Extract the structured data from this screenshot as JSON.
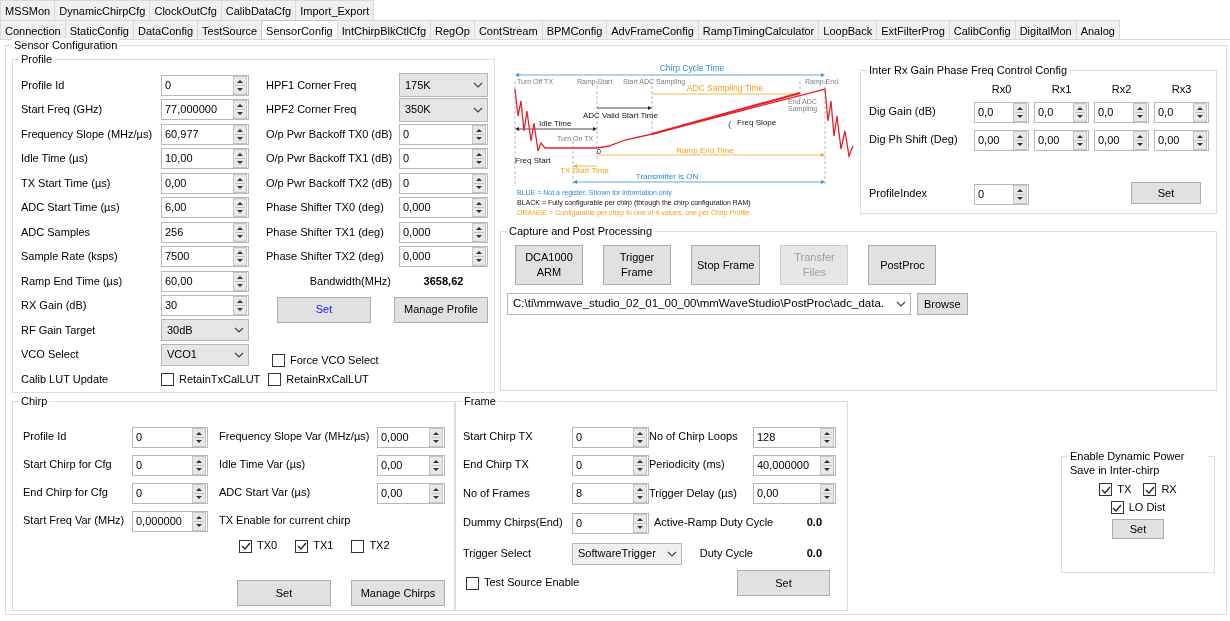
{
  "tab_rows": [
    [
      {
        "label": "MSSMon",
        "selected": false
      },
      {
        "label": "DynamicChirpCfg",
        "selected": false
      },
      {
        "label": "ClockOutCfg",
        "selected": false
      },
      {
        "label": "CalibDataCfg",
        "selected": false
      },
      {
        "label": "Import_Export",
        "selected": false
      }
    ],
    [
      {
        "label": "Connection",
        "selected": false
      },
      {
        "label": "StaticConfig",
        "selected": false
      },
      {
        "label": "DataConfig",
        "selected": false
      },
      {
        "label": "TestSource",
        "selected": false
      },
      {
        "label": "SensorConfig",
        "selected": true
      },
      {
        "label": "IntChirpBlkCtlCfg",
        "selected": false
      },
      {
        "label": "RegOp",
        "selected": false
      },
      {
        "label": "ContStream",
        "selected": false
      },
      {
        "label": "BPMConfig",
        "selected": false
      },
      {
        "label": "AdvFrameConfig",
        "selected": false
      },
      {
        "label": "RampTimingCalculator",
        "selected": false
      },
      {
        "label": "LoopBack",
        "selected": false
      },
      {
        "label": "ExtFilterProg",
        "selected": false
      },
      {
        "label": "CalibConfig",
        "selected": false
      },
      {
        "label": "DigitalMon",
        "selected": false
      },
      {
        "label": "Analog",
        "selected": false
      }
    ]
  ],
  "sensor": {
    "title": "Sensor Configuration"
  },
  "profile": {
    "title": "Profile",
    "left": [
      {
        "kind": "spin",
        "label": "Profile Id",
        "value": "0"
      },
      {
        "kind": "spin",
        "label": "Start Freq (GHz)",
        "value": "77,000000"
      },
      {
        "kind": "spin",
        "label": "Frequency Slope (MHz/µs)",
        "value": "60,977"
      },
      {
        "kind": "spin",
        "label": "Idle Time (µs)",
        "value": "10,00"
      },
      {
        "kind": "spin",
        "label": "TX Start Time (µs)",
        "value": "0,00"
      },
      {
        "kind": "spin",
        "label": "ADC Start Time (µs)",
        "value": "6,00"
      },
      {
        "kind": "spin",
        "label": "ADC Samples",
        "value": "256"
      },
      {
        "kind": "spin",
        "label": "Sample Rate (ksps)",
        "value": "7500"
      },
      {
        "kind": "spin",
        "label": "Ramp End Time (µs)",
        "value": "60,00"
      },
      {
        "kind": "spin",
        "label": "RX Gain (dB)",
        "value": "30"
      },
      {
        "kind": "select",
        "label": "RF Gain Target",
        "value": "30dB"
      },
      {
        "kind": "select",
        "label": "VCO Select",
        "value": "VCO1"
      }
    ],
    "right": [
      {
        "kind": "select",
        "label": "HPF1 Corner Freq",
        "value": "175K"
      },
      {
        "kind": "select",
        "label": "HPF2 Corner Freq",
        "value": "350K"
      },
      {
        "kind": "spin",
        "label": "O/p Pwr Backoff TX0 (dB)",
        "value": "0"
      },
      {
        "kind": "spin",
        "label": "O/p Pwr Backoff TX1 (dB)",
        "value": "0"
      },
      {
        "kind": "spin",
        "label": "O/p Pwr Backoff TX2 (dB)",
        "value": "0"
      },
      {
        "kind": "spin",
        "label": "Phase Shifter TX0 (deg)",
        "value": "0,000"
      },
      {
        "kind": "spin",
        "label": "Phase Shifter TX1 (deg)",
        "value": "0,000"
      },
      {
        "kind": "spin",
        "label": "Phase Shifter TX2 (deg)",
        "value": "0,000"
      }
    ],
    "bandwidth": {
      "label": "Bandwidth(MHz)",
      "value": "3658,62"
    },
    "buttons": [
      {
        "label": "Set",
        "focused": true
      },
      {
        "label": "Manage Profile",
        "focused": false
      }
    ],
    "force_vco": {
      "label": "Force VCO Select",
      "checked": false
    },
    "calib": {
      "label": "Calib LUT Update",
      "options": [
        {
          "label": "RetainTxCalLUT",
          "checked": false
        },
        {
          "label": "RetainRxCalLUT",
          "checked": false
        }
      ]
    }
  },
  "diagram": {
    "labels": [
      {
        "text": "Chirp Cycle Time",
        "kind": "info"
      },
      {
        "text": "Turn Off TX",
        "kind": "marker"
      },
      {
        "text": "Ramp Start",
        "kind": "marker"
      },
      {
        "text": "Start ADC Sampling",
        "kind": "marker"
      },
      {
        "text": "Ramp End",
        "kind": "marker"
      },
      {
        "text": "ADC Sampling Time",
        "kind": "profile"
      },
      {
        "text": "End ADC",
        "kind": "marker"
      },
      {
        "text": "Sampling",
        "kind": "marker"
      },
      {
        "text": "ADC Valid Start Time",
        "kind": "chirp"
      },
      {
        "text": "Idle Time",
        "kind": "chirp"
      },
      {
        "text": "Freq Slope",
        "kind": "chirp"
      },
      {
        "text": "Turn On TX",
        "kind": "marker"
      },
      {
        "text": "0",
        "kind": "chirp"
      },
      {
        "text": "Freq Start",
        "kind": "chirp"
      },
      {
        "text": "Ramp End Time",
        "kind": "profile"
      },
      {
        "text": "TX Start Time",
        "kind": "profile"
      },
      {
        "text": "Transmitter is ON",
        "kind": "info"
      },
      {
        "text": "BLUE = Not a register. Shown for information only",
        "kind": "info"
      },
      {
        "text": "BLACK = Fully configurable per chirp (through the chirp configuration RAM)",
        "kind": "chirp"
      },
      {
        "text": "ORANGE = Configurable per chirp to one of 4 values, one per Chirp Profile",
        "kind": "profile"
      }
    ]
  },
  "inter_rx": {
    "title": "Inter Rx Gain Phase Freq Control Config",
    "columns": [
      "Rx0",
      "Rx1",
      "Rx2",
      "Rx3"
    ],
    "rows": [
      {
        "label": "Dig Gain (dB)",
        "values": [
          "0,0",
          "0,0",
          "0,0",
          "0,0"
        ]
      },
      {
        "label": "Dig Ph Shift (Deg)",
        "values": [
          "0,00",
          "0,00",
          "0,00",
          "0,00"
        ]
      }
    ],
    "profile_index": {
      "label": "ProfileIndex",
      "value": "0"
    },
    "button": "Set"
  },
  "capture": {
    "title": "Capture and Post Processing",
    "buttons": [
      {
        "label": "DCA1000\nARM",
        "disabled": false
      },
      {
        "label": "Trigger\nFrame",
        "disabled": false
      },
      {
        "label": "Stop Frame",
        "disabled": false
      },
      {
        "label": "Transfer\nFiles",
        "disabled": true
      },
      {
        "label": "PostProc",
        "disabled": false
      }
    ],
    "path": "C:\\ti\\mmwave_studio_02_01_00_00\\mmWaveStudio\\PostProc\\adc_data.",
    "browse": "Browse"
  },
  "chirp": {
    "title": "Chirp",
    "left": [
      {
        "label": "Profile Id",
        "value": "0"
      },
      {
        "label": "Start Chirp for Cfg",
        "value": "0"
      },
      {
        "label": "End Chirp for Cfg",
        "value": "0"
      },
      {
        "label": "Start Freq Var (MHz)",
        "value": "0,000000"
      }
    ],
    "right": [
      {
        "label": "Frequency Slope Var (MHz/µs)",
        "value": "0,000"
      },
      {
        "label": "Idle Time Var (µs)",
        "value": "0,00"
      },
      {
        "label": "ADC Start Var (µs)",
        "value": "0,00"
      }
    ],
    "tx_enable": {
      "label": "TX Enable for current chirp",
      "options": [
        {
          "label": "TX0",
          "checked": true
        },
        {
          "label": "TX1",
          "checked": true
        },
        {
          "label": "TX2",
          "checked": false
        }
      ]
    },
    "buttons": [
      "Set",
      "Manage Chirps"
    ]
  },
  "frame": {
    "title": "Frame",
    "left": [
      {
        "kind": "spin",
        "label": "Start Chirp TX",
        "value": "0"
      },
      {
        "kind": "spin",
        "label": "End Chirp TX",
        "value": "0"
      },
      {
        "kind": "spin",
        "label": "No of Frames",
        "value": "8"
      },
      {
        "kind": "spin",
        "label": "Dummy Chirps(End)",
        "value": "0"
      },
      {
        "kind": "select",
        "label": "Trigger Select",
        "value": "SoftwareTrigger"
      }
    ],
    "right": [
      {
        "label": "No of Chirp Loops",
        "value": "128"
      },
      {
        "label": "Periodicity (ms)",
        "value": "40,000000"
      },
      {
        "label": "Trigger Delay (µs)",
        "value": "0,00"
      }
    ],
    "readouts": [
      {
        "label": "Active-Ramp Duty Cycle",
        "value": "0.0"
      },
      {
        "label": "Duty Cycle",
        "value": "0.0"
      }
    ],
    "test_source": {
      "label": "Test Source Enable",
      "checked": false
    },
    "button": "Set"
  },
  "dyn_power": {
    "title": "Enable Dynamic Power Save in Inter-chirp",
    "options": [
      {
        "label": "TX",
        "checked": true
      },
      {
        "label": "RX",
        "checked": true
      },
      {
        "label": "LO Dist",
        "checked": true
      }
    ],
    "button": "Set"
  }
}
